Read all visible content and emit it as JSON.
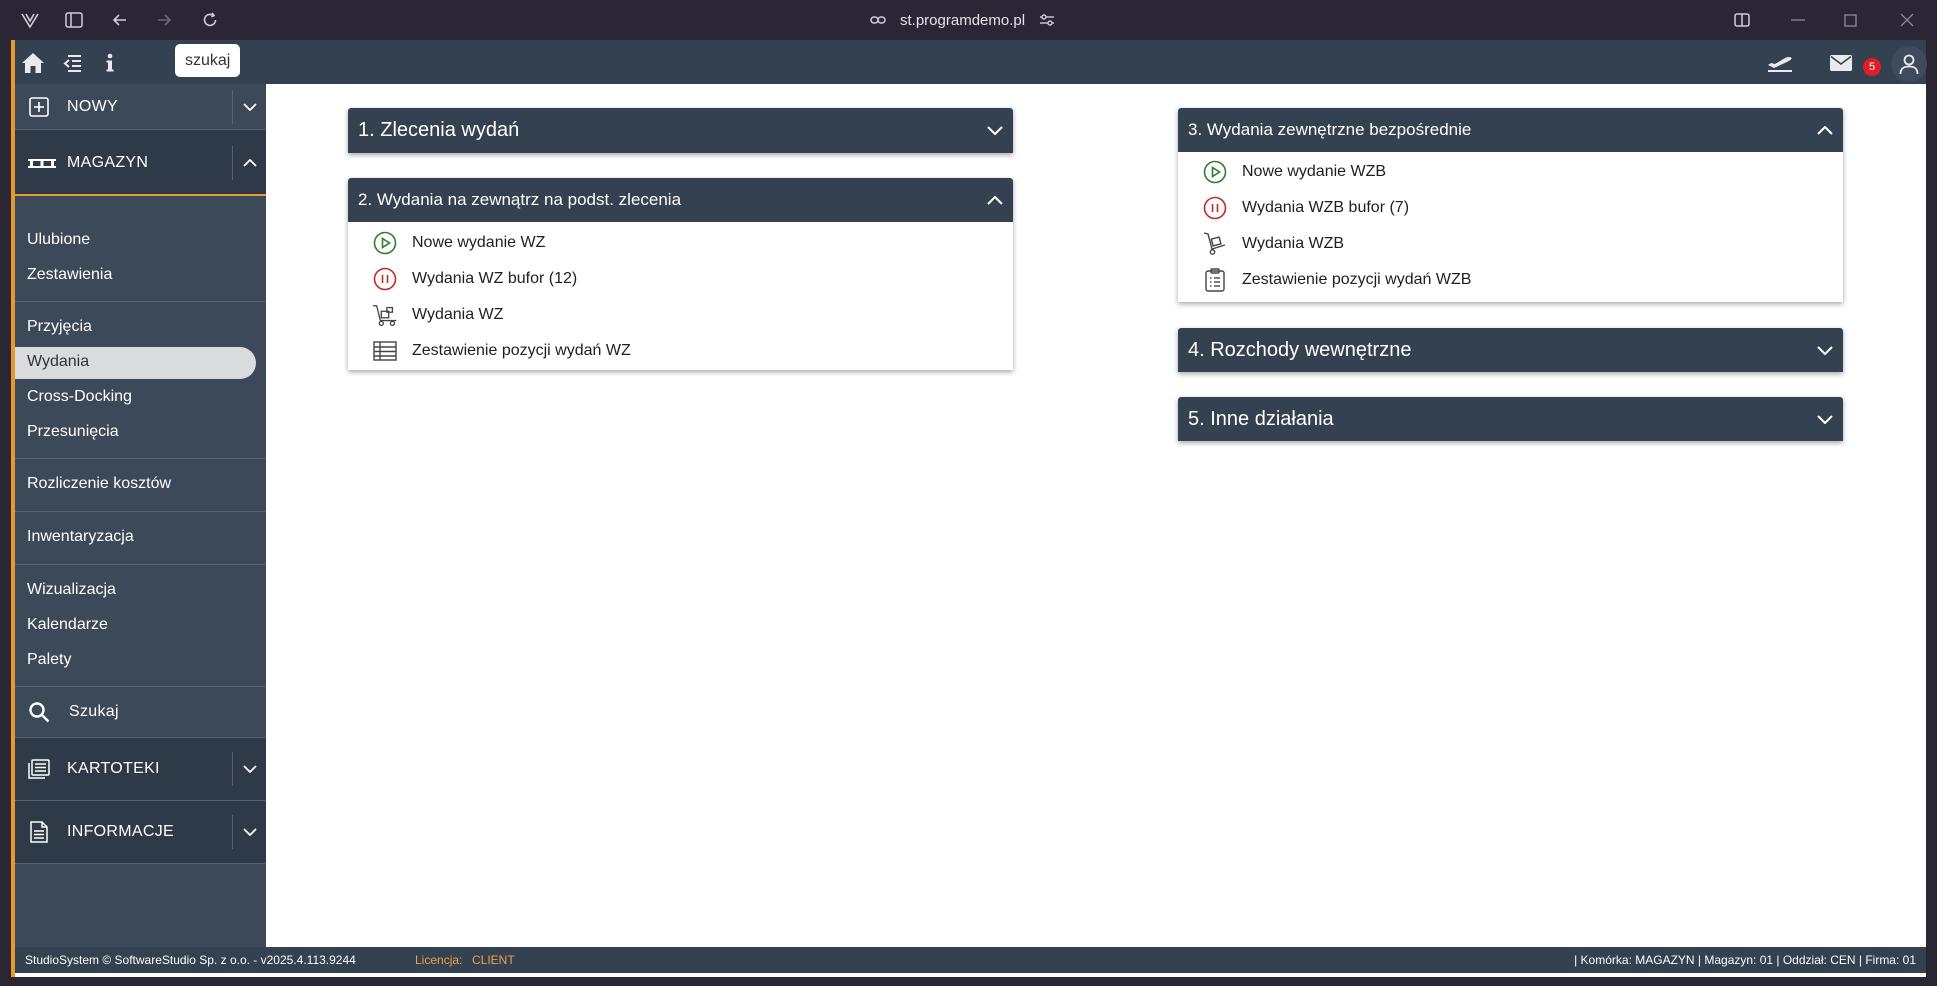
{
  "browser": {
    "url": "st.programdemo.pl"
  },
  "topbar": {
    "search_label": "szukaj",
    "mail_count": "5"
  },
  "sidebar": {
    "sections": {
      "nowy": "NOWY",
      "magazyn": "MAGAZYN",
      "kartoteki": "KARTOTEKI",
      "informacje": "INFORMACJE"
    },
    "items": {
      "ulubione": "Ulubione",
      "zestawienia": "Zestawienia",
      "przyjecia": "Przyjęcia",
      "wydania": "Wydania",
      "crossdocking": "Cross-Docking",
      "przesuniecia": "Przesunięcia",
      "rozliczenie": "Rozliczenie kosztów",
      "inwentaryzacja": "Inwentaryzacja",
      "wizualizacja": "Wizualizacja",
      "kalendarze": "Kalendarze",
      "palety": "Palety",
      "szukaj": "Szukaj"
    }
  },
  "panels": {
    "p1": {
      "title": "1. Zlecenia wydań"
    },
    "p2": {
      "title": "2. Wydania na zewnątrz na podst. zlecenia",
      "items": [
        "Nowe wydanie WZ",
        "Wydania WZ bufor (12)",
        "Wydania WZ",
        "Zestawienie pozycji wydań WZ"
      ]
    },
    "p3": {
      "title": "3. Wydania zewnętrzne bezpośrednie",
      "items": [
        "Nowe wydanie WZB",
        "Wydania WZB bufor (7)",
        "Wydania WZB",
        "Zestawienie pozycji wydań WZB"
      ]
    },
    "p4": {
      "title": "4. Rozchody wewnętrzne"
    },
    "p5": {
      "title": "5. Inne działania"
    }
  },
  "footer": {
    "copyright": "StudioSystem © SoftwareStudio Sp. z o.o. - v2025.4.113.9244",
    "license_label": "Licencja:",
    "license_value": "CLIENT",
    "status": "| Komórka: MAGAZYN | Magazyn: 01 | Oddział: CEN | Firma: 01"
  },
  "colors": {
    "accent": "#e59a2c",
    "header": "#334150",
    "sidebar": "#3c4959",
    "play": "#2e7d32",
    "pause": "#c62828"
  }
}
